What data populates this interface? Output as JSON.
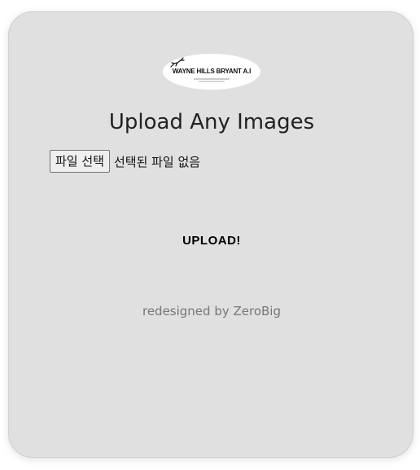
{
  "logo": {
    "text": "WAYNE HILLS BRYANT A.I",
    "icon": "leaping-deer-icon"
  },
  "page": {
    "title": "Upload Any Images"
  },
  "file_input": {
    "button_label": "파일 선택",
    "status_text": "선택된 파일 없음"
  },
  "upload": {
    "label": "UPLOAD!"
  },
  "footer": {
    "credit": "redesigned by ZeroBig"
  }
}
